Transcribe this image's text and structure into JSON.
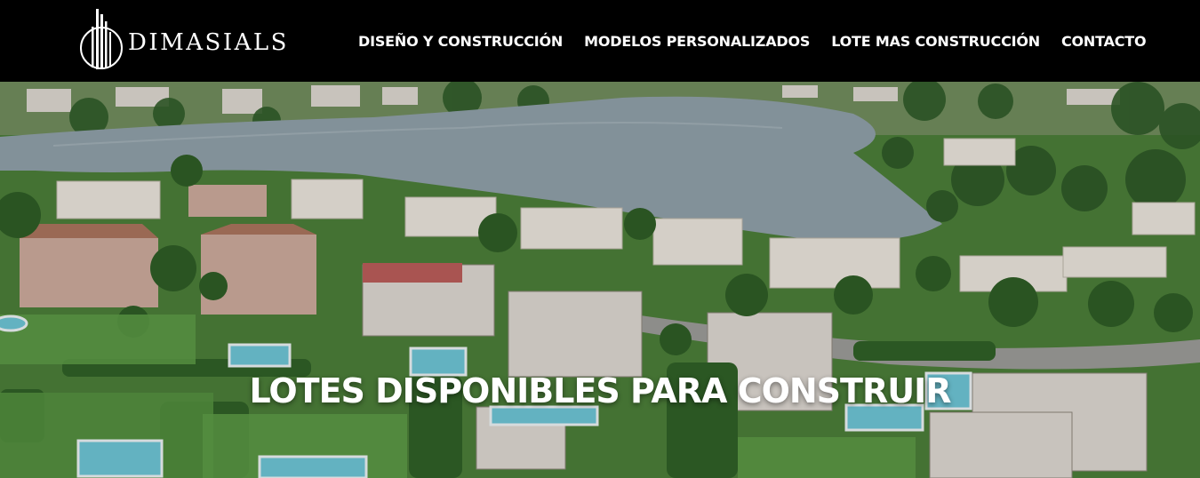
{
  "brand": {
    "name": "DIMASIALS",
    "logo_icon": "building-columns-logo"
  },
  "nav": {
    "items": [
      {
        "label": "DISEÑO Y CONSTRUCCIÓN"
      },
      {
        "label": "MODELOS PERSONALIZADOS"
      },
      {
        "label": "LOTE MAS CONSTRUCCIÓN"
      },
      {
        "label": "CONTACTO"
      }
    ]
  },
  "hero": {
    "title": "LOTES DISPONIBLES PARA CONSTRUIR",
    "image": "aerial-view-of-lakeside-neighborhood"
  },
  "colors": {
    "header_bg": "#000000",
    "nav_text": "#ffffff",
    "lake": "#8a9aa3",
    "lawn": "#4f8a3a"
  }
}
